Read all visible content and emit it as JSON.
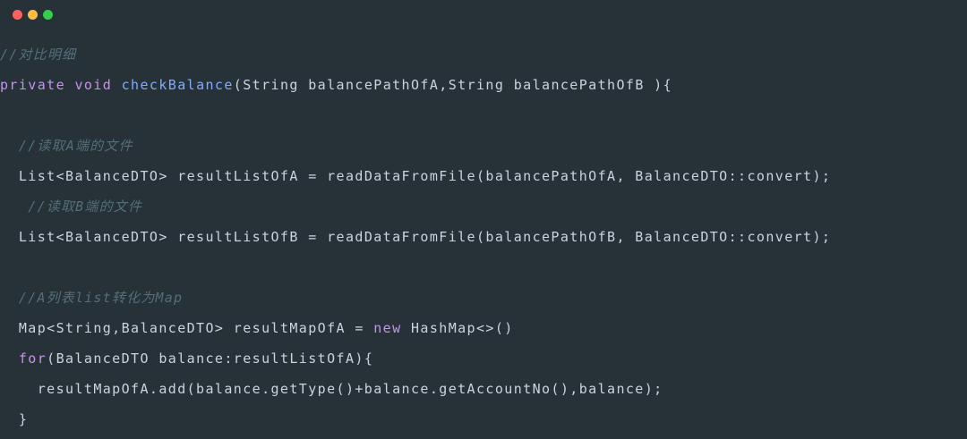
{
  "window": {
    "controls": {
      "close_color": "#fc625d",
      "minimize_color": "#fdbc40",
      "maximize_color": "#35cd4b"
    },
    "background": "#263238"
  },
  "theme": {
    "keyword": "#c792ea",
    "function": "#82aaff",
    "comment": "#546e7a",
    "text": "#cdd3de"
  },
  "code": {
    "lines": [
      {
        "indent": "",
        "tokens": [
          {
            "t": "c",
            "v": "//对比明细"
          }
        ]
      },
      {
        "indent": "",
        "tokens": [
          {
            "t": "k",
            "v": "private"
          },
          {
            "t": "p",
            "v": " "
          },
          {
            "t": "k",
            "v": "void"
          },
          {
            "t": "p",
            "v": " "
          },
          {
            "t": "f",
            "v": "checkBalance"
          },
          {
            "t": "p",
            "v": "(String balancePathOfA,String balancePathOfB ){"
          }
        ]
      },
      {
        "indent": "",
        "tokens": []
      },
      {
        "indent": "  ",
        "tokens": [
          {
            "t": "c",
            "v": "//读取A端的文件"
          }
        ]
      },
      {
        "indent": "  ",
        "tokens": [
          {
            "t": "p",
            "v": "List<BalanceDTO> resultListOfA = readDataFromFile(balancePathOfA, BalanceDTO::convert);"
          }
        ]
      },
      {
        "indent": "   ",
        "tokens": [
          {
            "t": "c",
            "v": "//读取B端的文件"
          }
        ]
      },
      {
        "indent": "  ",
        "tokens": [
          {
            "t": "p",
            "v": "List<BalanceDTO> resultListOfB = readDataFromFile(balancePathOfB, BalanceDTO::convert);"
          }
        ]
      },
      {
        "indent": "",
        "tokens": []
      },
      {
        "indent": "  ",
        "tokens": [
          {
            "t": "c",
            "v": "//A列表list转化为Map"
          }
        ]
      },
      {
        "indent": "  ",
        "tokens": [
          {
            "t": "p",
            "v": "Map<String,BalanceDTO> resultMapOfA = "
          },
          {
            "t": "k",
            "v": "new"
          },
          {
            "t": "p",
            "v": " HashMap<>()"
          }
        ]
      },
      {
        "indent": "  ",
        "tokens": [
          {
            "t": "k",
            "v": "for"
          },
          {
            "t": "p",
            "v": "(BalanceDTO balance:resultListOfA){"
          }
        ]
      },
      {
        "indent": "    ",
        "tokens": [
          {
            "t": "p",
            "v": "resultMapOfA.add(balance.getType()+balance.getAccountNo(),balance);"
          }
        ]
      },
      {
        "indent": "  ",
        "tokens": [
          {
            "t": "p",
            "v": "}"
          }
        ]
      }
    ]
  }
}
